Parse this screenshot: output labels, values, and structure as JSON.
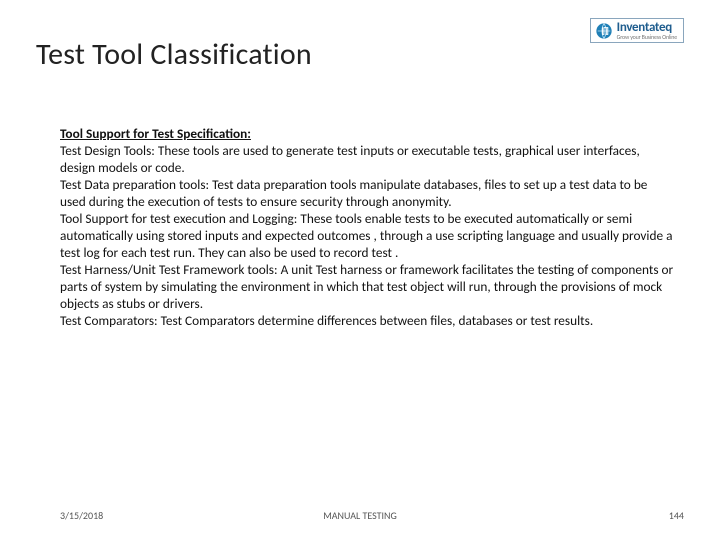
{
  "header": {
    "title": "Test Tool Classification",
    "logo": {
      "name": "Inventateq",
      "tagline": "Grow your Business Online",
      "icon": "globe-it-icon"
    }
  },
  "body": {
    "section_head": "Tool Support for Test Specification:",
    "p1_label": "Test Design Tools:",
    "p1_text": " These tools are used to generate test inputs or executable tests, graphical user interfaces, design models or code.",
    "p2_label": "Test Data preparation tools:",
    "p2_text": " Test data preparation tools manipulate databases, files to set up a test data to be used during the execution of tests to ensure security through anonymity.",
    "p3_label": "Tool Support for test execution and Logging:",
    "p3_text": " These tools enable tests to be executed automatically or semi automatically using stored inputs and expected outcomes , through a use scripting language and usually provide a  test log for each test run. They can also be used to record test .",
    "p4_label": "Test Harness/Unit Test Framework tools:",
    "p4_text": " A unit Test harness or framework facilitates the testing of components or parts of system by simulating the environment in which that test object will run, through the provisions of mock objects as stubs or drivers.",
    "p5_label": "Test Comparators:",
    "p5_text": " Test Comparators determine differences between files, databases or test results."
  },
  "footer": {
    "date": "3/15/2018",
    "center": "MANUAL TESTING",
    "page": "144"
  }
}
